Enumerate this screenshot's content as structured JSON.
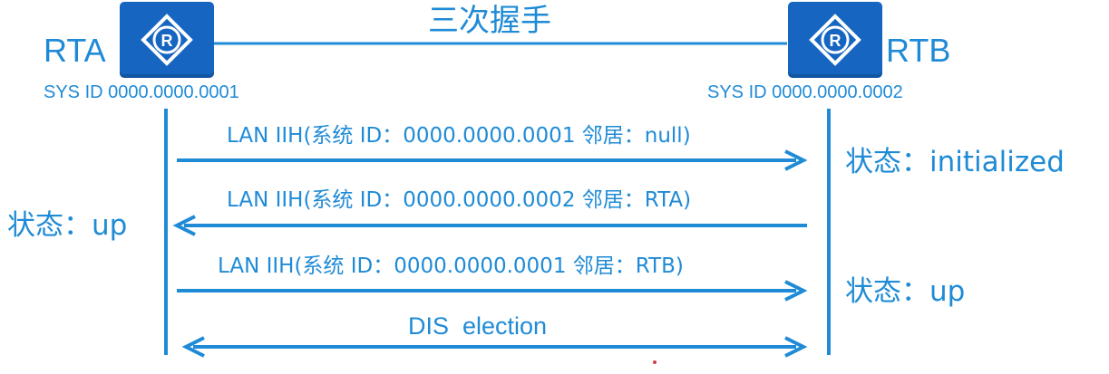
{
  "colors": {
    "line": "#1f8bd6",
    "router_bg": "#1665c0",
    "text": "#1f8bd6"
  },
  "title": "三次握手",
  "router_a": {
    "name": "RTA",
    "sys_id": "SYS ID 0000.0000.0001",
    "icon": "router-icon"
  },
  "router_b": {
    "name": "RTB",
    "sys_id": "SYS ID 0000.0000.0002",
    "icon": "router-icon"
  },
  "messages": [
    {
      "label": "LAN IIH(系统 ID：0000.0000.0001 邻居：null)",
      "direction": "A-to-B"
    },
    {
      "label": "LAN IIH(系统 ID：0000.0000.0002 邻居：RTA)",
      "direction": "B-to-A"
    },
    {
      "label": "LAN IIH(系统 ID：0000.0000.0001 邻居：RTB)",
      "direction": "A-to-B"
    },
    {
      "label": "DIS  election",
      "direction": "both"
    }
  ],
  "states": {
    "rtb_after_first": "状态：initialized",
    "rta_after_second": "状态：up",
    "rtb_after_third": "状态：up"
  }
}
